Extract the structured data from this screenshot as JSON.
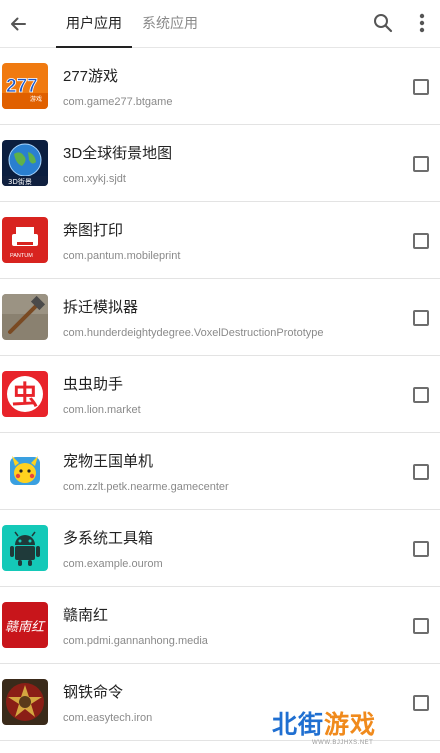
{
  "header": {
    "tabs": [
      {
        "label": "用户应用",
        "active": true
      },
      {
        "label": "系统应用",
        "active": false
      }
    ]
  },
  "apps": [
    {
      "name": "277游戏",
      "package": "com.game277.btgame",
      "icon": "277-game-icon",
      "checked": false
    },
    {
      "name": "3D全球街景地图",
      "package": "com.xykj.sjdt",
      "icon": "globe-street-map-icon",
      "checked": false
    },
    {
      "name": "奔图打印",
      "package": "com.pantum.mobileprint",
      "icon": "pantum-printer-icon",
      "checked": false
    },
    {
      "name": "拆迁模拟器",
      "package": "com.hunderdeightydegree.VoxelDestructionPrototype",
      "icon": "hammer-icon",
      "checked": false
    },
    {
      "name": "虫虫助手",
      "package": "com.lion.market",
      "icon": "chongchong-icon",
      "checked": false
    },
    {
      "name": "宠物王国单机",
      "package": "com.zzlt.petk.nearme.gamecenter",
      "icon": "pet-kingdom-icon",
      "checked": false
    },
    {
      "name": "多系统工具箱",
      "package": "com.example.ourom",
      "icon": "android-robot-icon",
      "checked": false
    },
    {
      "name": "赣南红",
      "package": "com.pdmi.gannanhong.media",
      "icon": "gannanhong-calligraphy-icon",
      "checked": false
    },
    {
      "name": "钢铁命令",
      "package": "com.easytech.iron",
      "icon": "iron-command-icon",
      "checked": false
    }
  ],
  "icon_text": {
    "game277": "277",
    "game277_sub": "游戏",
    "street_map": "3D街景",
    "pantum": "PANTUM",
    "chongchong": "虫",
    "gannanhong": "赣南红"
  },
  "watermark": {
    "blue": "北街",
    "orange": "游戏",
    "url": "WWW.BJJHXS.NET"
  },
  "colors": {
    "accent": "#222222",
    "inactive_tab": "#8a8a8a",
    "package_text": "#8a8a8a",
    "checkbox_border": "#6d6d6d",
    "watermark_blue": "#1f6fd1",
    "watermark_orange": "#f08a1c"
  }
}
